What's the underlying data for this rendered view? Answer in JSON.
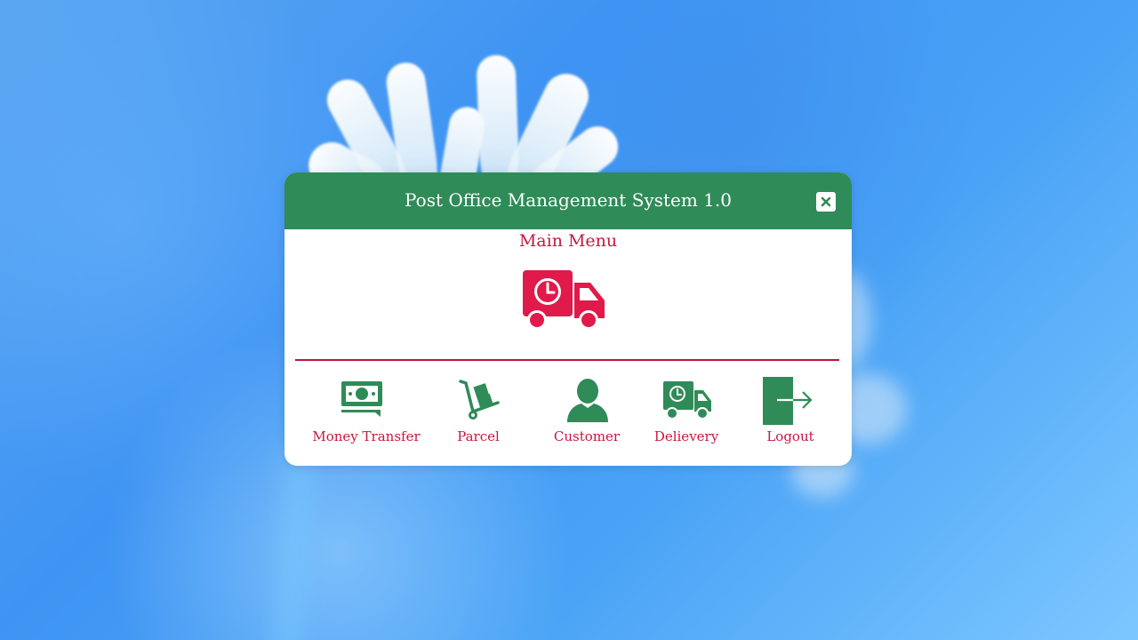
{
  "window": {
    "title": "Post Office Management System 1.0",
    "close_icon": "close-icon",
    "heading": "Main Menu",
    "hero_icon": "delivery-truck-icon"
  },
  "menu": [
    {
      "label": "Money Transfer",
      "icon": "money-icon"
    },
    {
      "label": "Parcel",
      "icon": "hand-truck-icon"
    },
    {
      "label": "Customer",
      "icon": "user-icon"
    },
    {
      "label": "Delievery",
      "icon": "delivery-truck-icon"
    },
    {
      "label": "Logout",
      "icon": "logout-icon"
    }
  ],
  "colors": {
    "titlebar": "#2f8b57",
    "accent_red": "#c8173f",
    "icon_green": "#2f8b57",
    "divider": "#b8173c"
  }
}
